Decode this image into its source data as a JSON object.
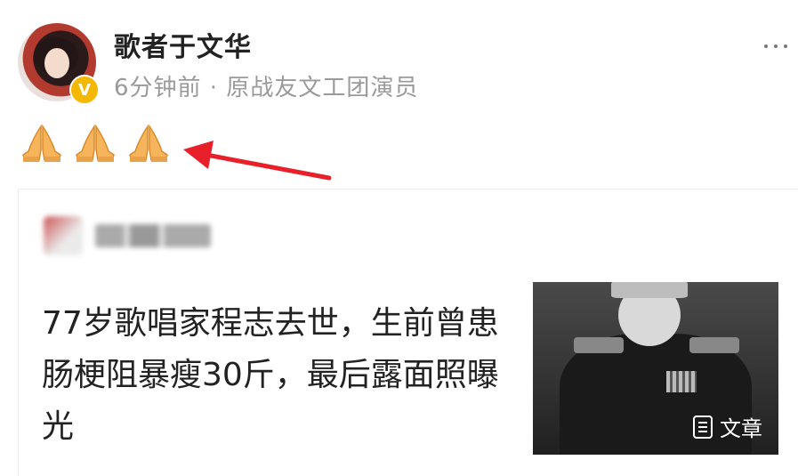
{
  "post": {
    "author_name": "歌者于文华",
    "verified_mark": "V",
    "meta": "6分钟前 · 原战友文工团演员",
    "emoji_icons": [
      "pray-icon",
      "pray-icon",
      "pray-icon"
    ]
  },
  "shared_article": {
    "headline": "77岁歌唱家程志去世，生前曾患肠梗阻暴瘦30斤，最后露面照曝光",
    "tag_label": "文章"
  },
  "colors": {
    "name": "#222222",
    "meta": "#9a9a9a",
    "verified_badge": "#f5b800",
    "arrow": "#e8202a"
  }
}
